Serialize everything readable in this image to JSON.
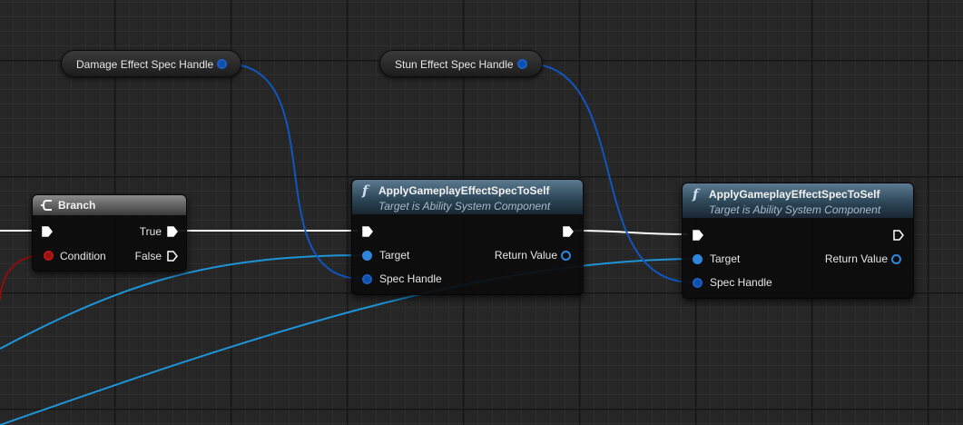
{
  "variables": {
    "damage": {
      "label": "Damage Effect Spec Handle"
    },
    "stun": {
      "label": "Stun Effect Spec Handle"
    }
  },
  "branch": {
    "title": "Branch",
    "true_label": "True",
    "false_label": "False",
    "condition_label": "Condition"
  },
  "apply1": {
    "title": "ApplyGameplayEffectSpecToSelf",
    "subtitle": "Target is Ability System Component",
    "target_label": "Target",
    "spec_label": "Spec Handle",
    "return_label": "Return Value"
  },
  "apply2": {
    "title": "ApplyGameplayEffectSpecToSelf",
    "subtitle": "Target is Ability System Component",
    "target_label": "Target",
    "spec_label": "Spec Handle",
    "return_label": "Return Value"
  },
  "colors": {
    "exec_wire": "#ffffff",
    "spec_wire": "#0f56c0",
    "target_wire": "#1e93d6",
    "condition_wire": "#8e0e0e"
  }
}
